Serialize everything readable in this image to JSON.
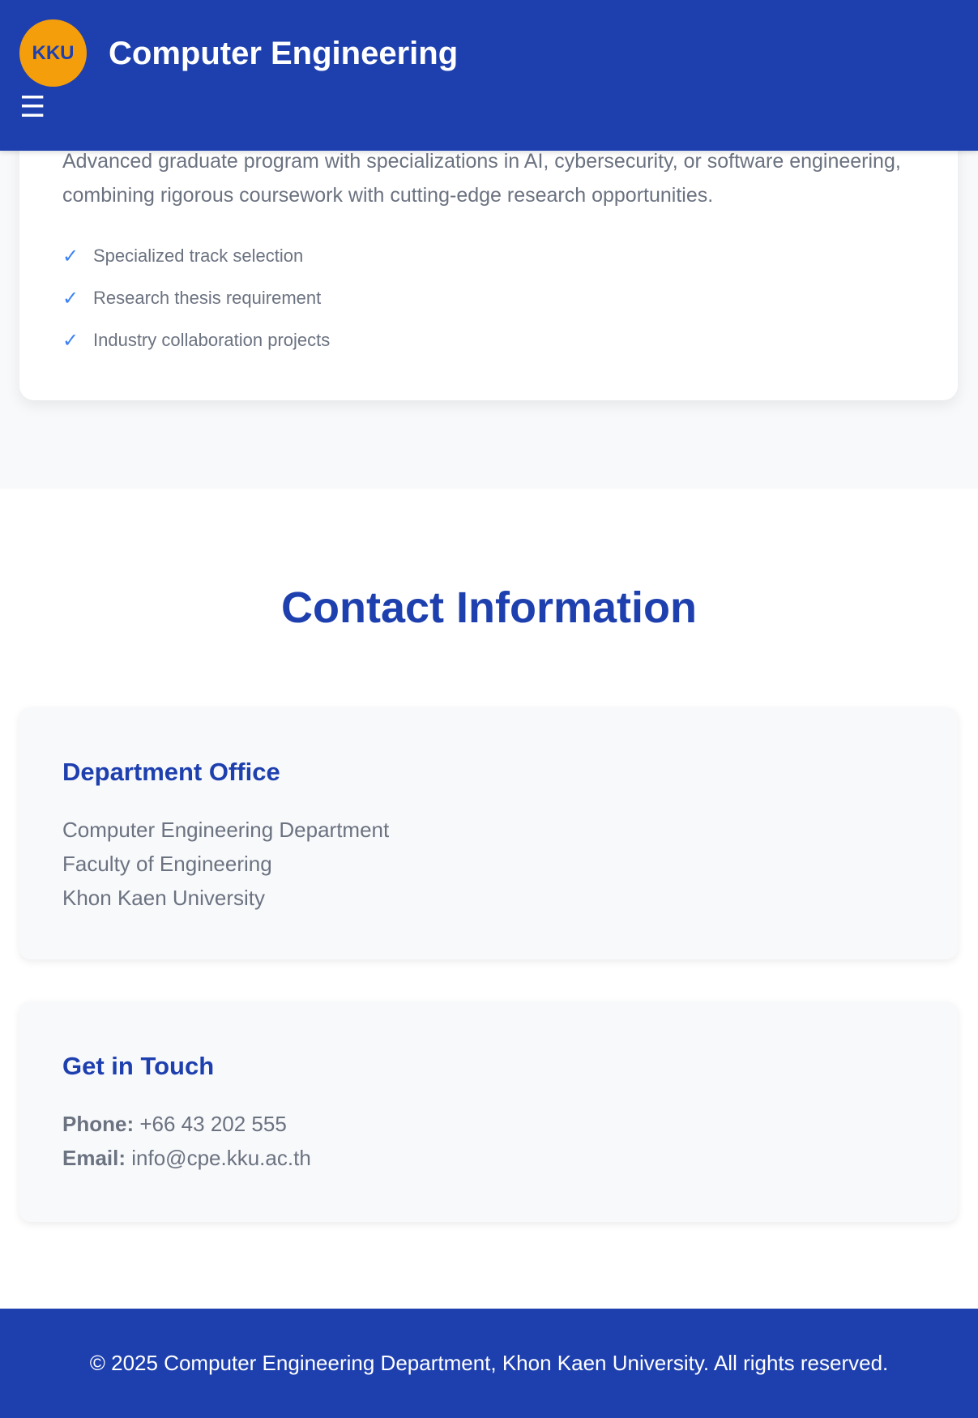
{
  "header": {
    "logo_text": "KKU",
    "title": "Computer Engineering",
    "menu_icon": "☰"
  },
  "program": {
    "description": "Advanced graduate program with specializations in AI, cybersecurity, or software engineering, combining rigorous coursework with cutting-edge research opportunities.",
    "check_icon": "✓",
    "features": [
      "Specialized track selection",
      "Research thesis requirement",
      "Industry collaboration projects"
    ]
  },
  "contact": {
    "title": "Contact Information",
    "office": {
      "heading": "Department Office",
      "lines": [
        "Computer Engineering Department",
        "Faculty of Engineering",
        "Khon Kaen University"
      ]
    },
    "touch": {
      "heading": "Get in Touch",
      "phone_label": "Phone:",
      "phone": "+66 43 202 555",
      "email_label": "Email:",
      "email": "info@cpe.kku.ac.th"
    }
  },
  "footer": {
    "text": "© 2025 Computer Engineering Department, Khon Kaen University. All rights reserved."
  },
  "colors": {
    "primary": "#1e40af",
    "accent": "#f59e0b",
    "check": "#3b82f6",
    "text": "#6b7280"
  }
}
